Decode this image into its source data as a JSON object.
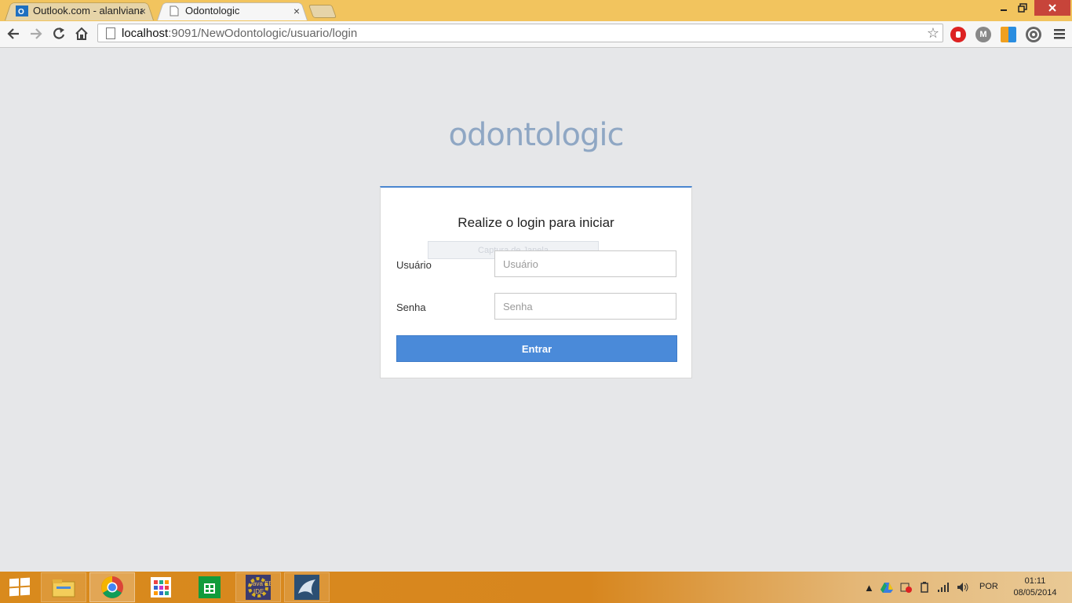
{
  "browser": {
    "tabs": [
      {
        "title": "Outlook.com - alanlvianat",
        "icon": "outlook-icon",
        "active": false
      },
      {
        "title": "Odontologic",
        "icon": "page-icon",
        "active": true
      }
    ],
    "close_glyph": "×",
    "url_host": "localhost",
    "url_rest": ":9091/NewOdontologic/usuario/login"
  },
  "page": {
    "logo": "odontologic",
    "title": "Realize o login para iniciar",
    "ghost_tooltip": "Captura de Janela",
    "username": {
      "label": "Usuário",
      "placeholder": "Usuário",
      "value": ""
    },
    "password": {
      "label": "Senha",
      "placeholder": "Senha",
      "value": ""
    },
    "submit_label": "Entrar"
  },
  "taskbar": {
    "apps": [
      "file-explorer-icon",
      "chrome-icon",
      "apps-grid-icon",
      "store-icon",
      "java-ee-ide-icon",
      "mysql-workbench-icon"
    ],
    "language": "POR",
    "time": "01:11",
    "date": "08/05/2014"
  },
  "colors": {
    "titlebar": "#f2c45e",
    "accent": "#4a8ad9",
    "logo": "#8fa7c4",
    "page_bg": "#e6e7e9",
    "taskbar": "#d98a1d"
  }
}
